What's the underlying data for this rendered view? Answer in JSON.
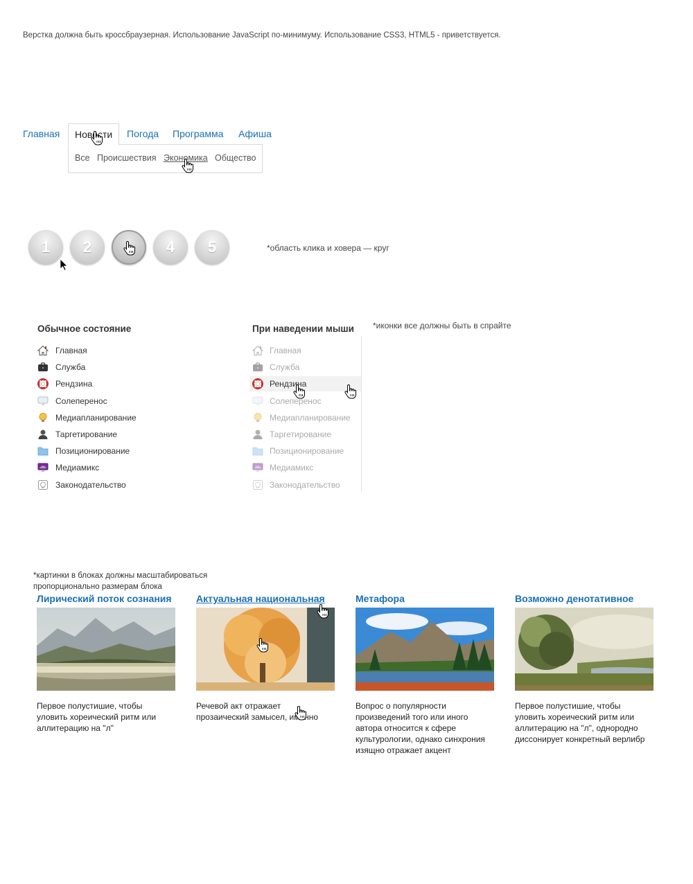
{
  "intro": "Верстка должна быть кроссбраузерная. Использование JavaScript по-минимуму. Использование CSS3, HTML5 - приветствуется.",
  "nav": {
    "items": [
      "Главная",
      "Новости",
      "Погода",
      "Программа",
      "Афиша"
    ],
    "active_index": 1,
    "sub_items": [
      "Все",
      "Происшествия",
      "Экономика",
      "Общество"
    ],
    "sub_hover_index": 2
  },
  "pager": {
    "items": [
      "1",
      "2",
      "3",
      "4",
      "5"
    ],
    "hover_index": 2,
    "note": "*область клика и ховера — круг"
  },
  "icon_lists": {
    "normal_title": "Обычное состояние",
    "hover_title": "При наведении мыши",
    "sprite_note": "*иконки все должны быть в спрайте",
    "hover_index": 2,
    "items": [
      {
        "label": "Главная",
        "icon": "home-icon"
      },
      {
        "label": "Служба",
        "icon": "briefcase-icon"
      },
      {
        "label": "Рендзина",
        "icon": "lifebuoy-icon"
      },
      {
        "label": "Солеперенос",
        "icon": "monitor-icon"
      },
      {
        "label": "Медиапланирование",
        "icon": "lightbulb-icon"
      },
      {
        "label": "Таргетирование",
        "icon": "user-icon"
      },
      {
        "label": "Позиционирование",
        "icon": "folder-icon"
      },
      {
        "label": "Медиамикс",
        "icon": "display-icon"
      },
      {
        "label": "Законодательство",
        "icon": "document-icon"
      }
    ]
  },
  "cards": {
    "note_line1": "*картинки в блоках должны масштабироваться",
    "note_line2": "пропорционально размерам блока",
    "hover_index": 1,
    "items": [
      {
        "title": "Лирический поток сознания",
        "text": "Первое полустишие, чтобы уловить хореический ритм или аллитерацию на \"л\"",
        "image": "mountain-lake-fog"
      },
      {
        "title": "Актуальная национальная",
        "text": "Речевой акт отражает прозаический замысел, именно",
        "image": "autumn-tree"
      },
      {
        "title": "Метафора",
        "text": "Вопрос о популярности произведений того или иного автора относится к сфере культурологии, однако синхрония изящно отражает акцент",
        "image": "mountain-lake-forest"
      },
      {
        "title": "Возможно денотативное",
        "text": "Первое полустишие, чтобы уловить хореический ритм или аллитерацию на \"л\", однородно диссонирует конкретный верлибр",
        "image": "river-landscape-painting"
      }
    ]
  },
  "colors": {
    "link": "#1a6fb5",
    "text": "#333333",
    "muted": "#aaaaaa"
  }
}
